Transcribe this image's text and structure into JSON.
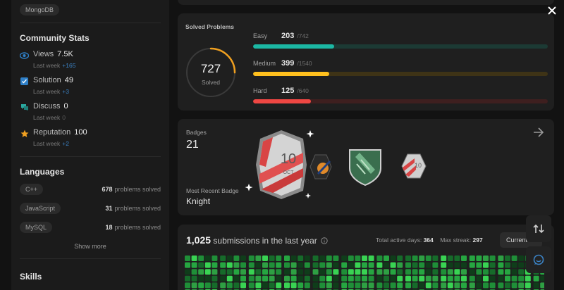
{
  "sidebar": {
    "top_tag": "MongoDB",
    "community_title": "Community Stats",
    "stats": [
      {
        "label": "Views",
        "value": "7.5K",
        "sub": "Last week",
        "delta": "+165",
        "icon": "eye-icon",
        "color": "#2f80c8"
      },
      {
        "label": "Solution",
        "value": "49",
        "sub": "Last week",
        "delta": "+3",
        "icon": "solution-checkbox-icon",
        "color": "#2f80c8"
      },
      {
        "label": "Discuss",
        "value": "0",
        "sub": "Last week",
        "delta": "0",
        "icon": "discuss-bubble-icon",
        "color": "#2aa9a0"
      },
      {
        "label": "Reputation",
        "value": "100",
        "sub": "Last week",
        "delta": "+2",
        "icon": "star-icon",
        "color": "#f0a020"
      }
    ],
    "languages_title": "Languages",
    "languages": [
      {
        "name": "C++",
        "count": "678",
        "suffix": "problems solved"
      },
      {
        "name": "JavaScript",
        "count": "31",
        "suffix": "problems solved"
      },
      {
        "name": "MySQL",
        "count": "18",
        "suffix": "problems solved"
      }
    ],
    "show_more": "Show more",
    "skills_title": "Skills"
  },
  "solved": {
    "title": "Solved Problems",
    "total": "727",
    "total_label": "Solved",
    "ring_fraction": 0.25,
    "ring_color": "#f0a020",
    "levels": [
      {
        "name": "Easy",
        "count": "203",
        "total": "/742",
        "fraction": 0.274,
        "color": "#1cb8a4",
        "track": "#1c3a34"
      },
      {
        "name": "Medium",
        "count": "399",
        "total": "/1540",
        "fraction": 0.259,
        "color": "#ffc01e",
        "track": "#3e3316"
      },
      {
        "name": "Hard",
        "count": "125",
        "total": "/640",
        "fraction": 0.195,
        "color": "#ef4743",
        "track": "#3e1f1f"
      }
    ]
  },
  "badges": {
    "label": "Badges",
    "count": "21",
    "recent_label": "Most Recent Badge",
    "recent_name": "Knight",
    "badge_icons": [
      "featured-oct-badge-icon",
      "annual-badge-icon",
      "knight-badge-icon",
      "monthly-badge-icon"
    ],
    "badge_text": "10",
    "badge_month": "OCT"
  },
  "submissions": {
    "count": "1,025",
    "text": "submissions in the last year",
    "active_label": "Total active days:",
    "active_value": "364",
    "streak_label": "Max streak:",
    "streak_value": "297",
    "current_label": "Current"
  }
}
